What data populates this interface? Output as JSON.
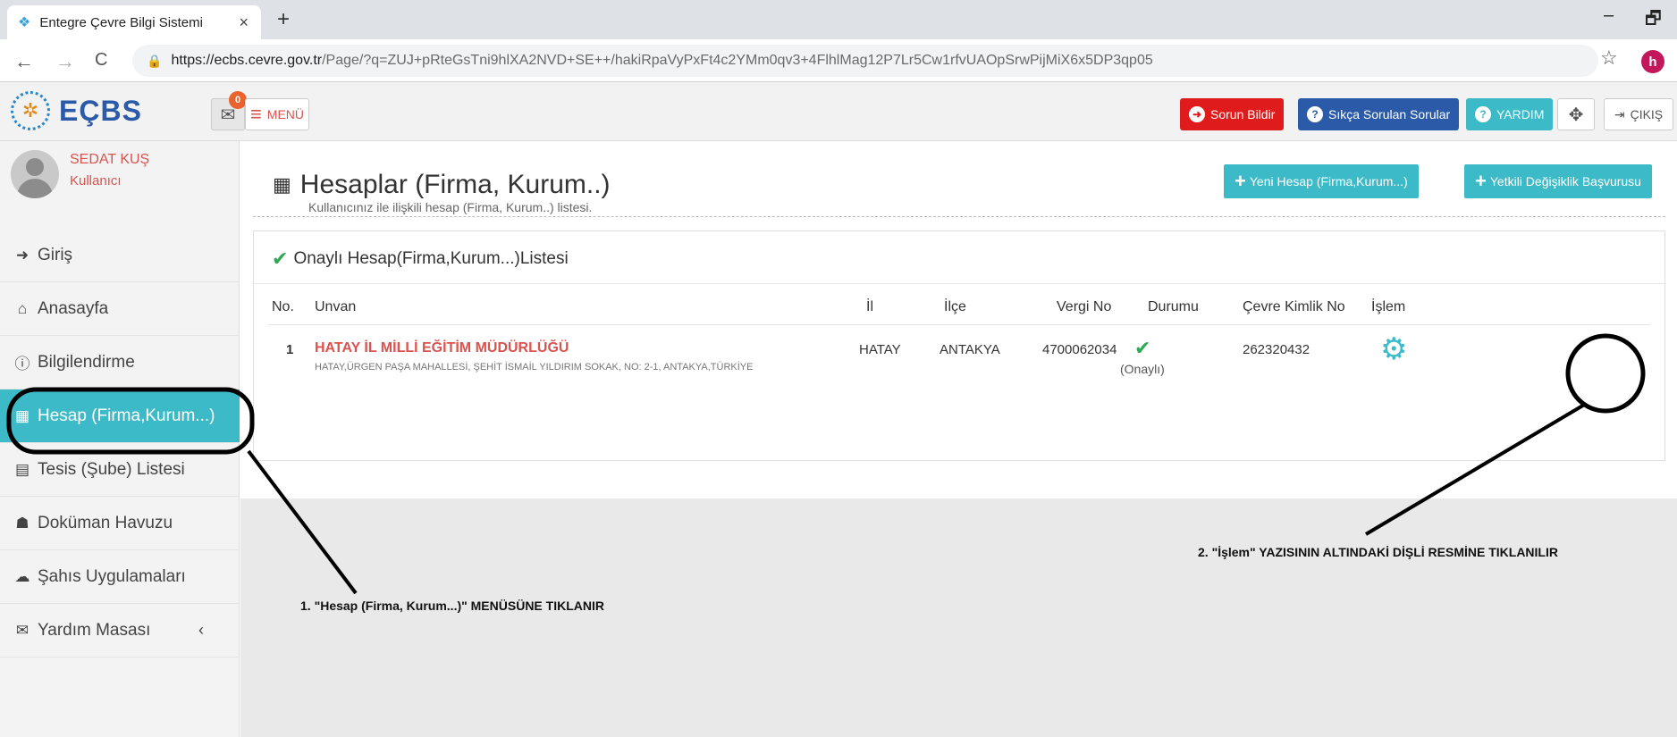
{
  "browser": {
    "tab_title": "Entegre Çevre Bilgi Sistemi",
    "tab_close": "×",
    "new_tab": "+",
    "minimize": "–",
    "restore": "🗗",
    "back": "←",
    "forward": "→",
    "reload": "C",
    "url_domain": "https://ecbs.cevre.gov.tr",
    "url_path": "/Page/?q=ZUJ+pRteGsTni9hlXA2NVD+SE++/hakiRpaVyPxFt4c2YMm0qv3+4FlhlMag12P7Lr5Cw1rfvUAOpSrwPijMiX6x5DP3qp05",
    "star": "☆",
    "profile_initial": "h"
  },
  "header": {
    "logo_text": "EÇBS",
    "mail_badge": "0",
    "menu_label": "MENÜ",
    "report_issue": "Sorun Bildir",
    "faq": "Sıkça Sorulan Sorular",
    "help": "YARDIM",
    "exit": "ÇIKIŞ",
    "colors": {
      "danger": "#e01b1b",
      "primary": "#2b5aa8",
      "info": "#3cbac8"
    }
  },
  "user": {
    "name": "SEDAT KUŞ",
    "role": "Kullanıcı"
  },
  "sidebar": {
    "items": [
      {
        "label": "Giriş",
        "icon": "sign-in-icon"
      },
      {
        "label": "Anasayfa",
        "icon": "home-icon"
      },
      {
        "label": "Bilgilendirme",
        "icon": "info-icon"
      },
      {
        "label": "Hesap (Firma,Kurum...)",
        "icon": "building-icon",
        "active": true
      },
      {
        "label": "Tesis (Şube) Listesi",
        "icon": "clipboard-icon"
      },
      {
        "label": "Doküman Havuzu",
        "icon": "users-icon"
      },
      {
        "label": "Şahıs Uygulamaları",
        "icon": "cloud-icon"
      },
      {
        "label": "Yardım Masası",
        "icon": "envelope-icon"
      }
    ]
  },
  "page": {
    "title": "Hesaplar (Firma, Kurum..)",
    "subtitle": "Kullanıcınız ile ilişkili hesap (Firma, Kurum..) listesi.",
    "new_account_button": "Yeni Hesap (Firma,Kurum...)",
    "authority_change_button": "Yetkili Değişiklik Başvurusu"
  },
  "panel": {
    "title": "Onaylı Hesap(Firma,Kurum...)Listesi",
    "columns": [
      "No.",
      "Unvan",
      "İl",
      "İlçe",
      "Vergi No",
      "Durumu",
      "Çevre Kimlik No",
      "İşlem"
    ],
    "rows": [
      {
        "no": "1",
        "unvan": "HATAY İL MİLLİ EĞİTİM MÜDÜRLÜĞÜ",
        "adres": "HATAY,ÜRGEN PAŞA MAHALLESİ, ŞEHİT İSMAİL YILDIRIM SOKAK, NO: 2-1, ANTAKYA,TÜRKİYE",
        "il": "HATAY",
        "ilce": "ANTAKYA",
        "vergi_no": "4700062034",
        "durum": "(Onaylı)",
        "cevre_kimlik_no": "262320432"
      }
    ]
  },
  "annotations": {
    "step1": "1. \"Hesap (Firma, Kurum...)\" MENÜSÜNE TIKLANIR",
    "step2": "2. \"İşlem\" YAZISININ ALTINDAKİ DİŞLİ RESMİNE TIKLANILIR"
  }
}
